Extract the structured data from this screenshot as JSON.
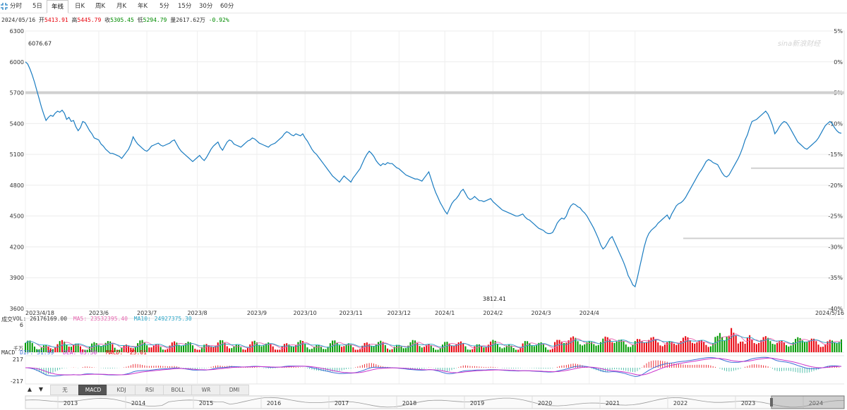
{
  "tabs": [
    {
      "label": "分时",
      "active": false
    },
    {
      "label": "5日",
      "active": false
    },
    {
      "label": "年线",
      "active": true
    },
    {
      "label": "日K",
      "active": false
    },
    {
      "label": "周K",
      "active": false
    },
    {
      "label": "月K",
      "active": false
    },
    {
      "label": "年K",
      "active": false
    },
    {
      "label": "5分",
      "active": false
    },
    {
      "label": "15分",
      "active": false
    },
    {
      "label": "30分",
      "active": false
    },
    {
      "label": "60分",
      "active": false
    }
  ],
  "info": {
    "date": "2024/05/16",
    "open_label": "开",
    "open": "5413.91",
    "high_label": "高",
    "high": "5445.79",
    "close_label": "收",
    "close": "5305.45",
    "low_label": "低",
    "low": "5294.79",
    "vol_label": "量",
    "vol": "2617.62万",
    "change": "-0.92%"
  },
  "watermark": "sina新浪财经",
  "volume_legend": {
    "title": "成交",
    "vol": "VOL: 26176169.00",
    "ma5": "MA5: 23532395.40",
    "ma10": "MA10: 24927375.30",
    "top_tick": "6",
    "unit_label": "千万"
  },
  "macd_legend": {
    "title": "MACD",
    "dif": "DIF: 51.99",
    "dea": "DEA: 63.50",
    "macd": "MACD: -23.01",
    "top_tick": "217",
    "bottom_tick": "-217"
  },
  "indicator_tabs": [
    {
      "label": "无",
      "active": false
    },
    {
      "label": "MACD",
      "active": true
    },
    {
      "label": "KDJ",
      "active": false
    },
    {
      "label": "RSI",
      "active": false
    },
    {
      "label": "BOLL",
      "active": false
    },
    {
      "label": "WR",
      "active": false
    },
    {
      "label": "DMI",
      "active": false
    }
  ],
  "nav_arrows": {
    "up": "▲",
    "down": "▼"
  },
  "navigator_years": [
    "2013",
    "2014",
    "2015",
    "2016",
    "2017",
    "2018",
    "2019",
    "2020",
    "2021",
    "2022",
    "2023",
    "2024"
  ],
  "colors": {
    "line": "#1a7cc1",
    "up": "#e8000b",
    "down": "#009a00",
    "ma5": "#e766b0",
    "ma10": "#2aa6c8",
    "dif": "#3d6fd6",
    "dea": "#cc33cc",
    "hband": "#d0d0d0"
  },
  "chart_data": {
    "type": "line",
    "title": "",
    "ylabel": "",
    "xlabel": "",
    "ylim": [
      3600,
      6300
    ],
    "yticks": [
      6300,
      6000,
      5700,
      5400,
      5100,
      4800,
      4500,
      4200,
      3900,
      3600
    ],
    "pct_ticks": [
      "5%",
      "0%",
      "-5%",
      "-10%",
      "-15%",
      "-20%",
      "-25%",
      "-30%",
      "-35%",
      "-40%"
    ],
    "x_labels": [
      "2023/4/18",
      "2023/6",
      "2023/7",
      "2023/8",
      "2023/9",
      "2023/10",
      "2023/11",
      "2023/12",
      "2024/1",
      "2024/2",
      "2024/3",
      "2024/4",
      "2024/5/16"
    ],
    "x_label_index": [
      0,
      32,
      53,
      75,
      101,
      122,
      142,
      163,
      183,
      204,
      225,
      246,
      266
    ],
    "annotations": [
      {
        "text": "6076.67",
        "index": 0,
        "value": 6076.67
      },
      {
        "text": "3812.41",
        "index": 204,
        "value": 3812.41
      }
    ],
    "series": [
      {
        "values": [
          6000,
          5980,
          5930,
          5870,
          5800,
          5720,
          5640,
          5560,
          5490,
          5430,
          5460,
          5480,
          5470,
          5500,
          5520,
          5510,
          5530,
          5500,
          5440,
          5460,
          5420,
          5430,
          5370,
          5330,
          5360,
          5420,
          5410,
          5370,
          5330,
          5300,
          5260,
          5250,
          5240,
          5200,
          5180,
          5150,
          5130,
          5110,
          5110,
          5100,
          5090,
          5080,
          5060,
          5090,
          5120,
          5150,
          5200,
          5270,
          5230,
          5200,
          5180,
          5160,
          5140,
          5130,
          5150,
          5180,
          5190,
          5200,
          5210,
          5190,
          5180,
          5190,
          5200,
          5210,
          5230,
          5240,
          5200,
          5160,
          5130,
          5110,
          5090,
          5070,
          5050,
          5030,
          5050,
          5070,
          5090,
          5060,
          5040,
          5070,
          5110,
          5150,
          5180,
          5200,
          5220,
          5170,
          5140,
          5180,
          5220,
          5240,
          5230,
          5200,
          5190,
          5180,
          5170,
          5190,
          5210,
          5230,
          5240,
          5260,
          5250,
          5230,
          5210,
          5200,
          5190,
          5180,
          5170,
          5190,
          5200,
          5210,
          5230,
          5250,
          5270,
          5300,
          5320,
          5310,
          5290,
          5280,
          5300,
          5290,
          5280,
          5300,
          5260,
          5230,
          5190,
          5150,
          5120,
          5100,
          5070,
          5040,
          5010,
          4980,
          4950,
          4920,
          4890,
          4870,
          4850,
          4830,
          4860,
          4890,
          4870,
          4850,
          4830,
          4870,
          4900,
          4930,
          4960,
          5010,
          5060,
          5100,
          5130,
          5110,
          5080,
          5040,
          5010,
          4990,
          5010,
          5000,
          5020,
          5010,
          5010,
          4990,
          4970,
          4960,
          4940,
          4920,
          4900,
          4890,
          4880,
          4870,
          4860,
          4860,
          4850,
          4840,
          4870,
          4900,
          4930,
          4860,
          4790,
          4730,
          4680,
          4630,
          4590,
          4550,
          4520,
          4570,
          4620,
          4650,
          4670,
          4700,
          4740,
          4760,
          4720,
          4680,
          4660,
          4670,
          4690,
          4670,
          4650,
          4650,
          4640,
          4650,
          4660,
          4670,
          4640,
          4620,
          4600,
          4580,
          4560,
          4550,
          4540,
          4530,
          4520,
          4510,
          4500,
          4500,
          4510,
          4520,
          4490,
          4470,
          4460,
          4440,
          4420,
          4400,
          4380,
          4370,
          4360,
          4340,
          4330,
          4330,
          4340,
          4380,
          4430,
          4460,
          4480,
          4470,
          4500,
          4560,
          4600,
          4620,
          4610,
          4590,
          4580,
          4550,
          4530,
          4500,
          4460,
          4420,
          4380,
          4330,
          4280,
          4220,
          4180,
          4200,
          4240,
          4280,
          4300,
          4250,
          4200,
          4150,
          4100,
          4050,
          3990,
          3920,
          3880,
          3830,
          3812.41,
          3900,
          4000,
          4100,
          4200,
          4280,
          4330,
          4360,
          4380,
          4400,
          4430,
          4450,
          4470,
          4490,
          4510,
          4470,
          4520,
          4560,
          4600,
          4620,
          4630,
          4650,
          4680,
          4720,
          4760,
          4800,
          4840,
          4880,
          4920,
          4950,
          4990,
          5030,
          5050,
          5040,
          5020,
          5010,
          5000,
          4960,
          4920,
          4890,
          4880,
          4900,
          4940,
          4980,
          5020,
          5060,
          5110,
          5170,
          5240,
          5290,
          5360,
          5420,
          5430,
          5440,
          5460,
          5480,
          5500,
          5520,
          5490,
          5440,
          5380,
          5300,
          5330,
          5370,
          5400,
          5420,
          5410,
          5380,
          5340,
          5300,
          5260,
          5220,
          5200,
          5180,
          5160,
          5150,
          5170,
          5190,
          5210,
          5230,
          5260,
          5300,
          5340,
          5380,
          5400,
          5420,
          5400,
          5360,
          5330,
          5310,
          5305.45
        ]
      }
    ]
  }
}
